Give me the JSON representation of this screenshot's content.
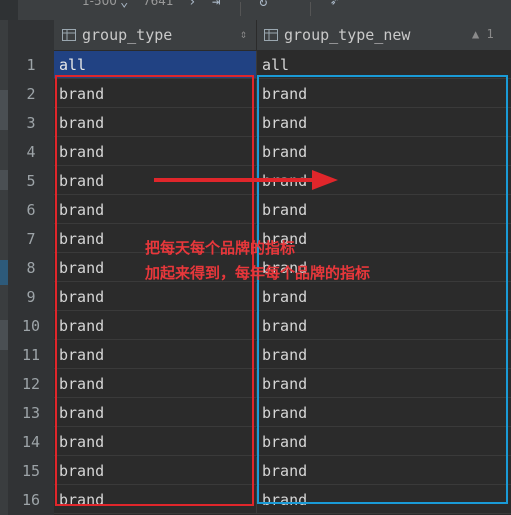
{
  "toolbar": {
    "range_label": "1-500",
    "total_label": "7641"
  },
  "columns": [
    {
      "name": "group_type",
      "sort_indicator": "⇕"
    },
    {
      "name": "group_type_new",
      "sort_indicator": "▲ 1"
    }
  ],
  "rows": [
    {
      "num": "1",
      "group_type": "all",
      "group_type_new": "all"
    },
    {
      "num": "2",
      "group_type": "brand",
      "group_type_new": "brand"
    },
    {
      "num": "3",
      "group_type": "brand",
      "group_type_new": "brand"
    },
    {
      "num": "4",
      "group_type": "brand",
      "group_type_new": "brand"
    },
    {
      "num": "5",
      "group_type": "brand",
      "group_type_new": "brand"
    },
    {
      "num": "6",
      "group_type": "brand",
      "group_type_new": "brand"
    },
    {
      "num": "7",
      "group_type": "brand",
      "group_type_new": "brand"
    },
    {
      "num": "8",
      "group_type": "brand",
      "group_type_new": "brand"
    },
    {
      "num": "9",
      "group_type": "brand",
      "group_type_new": "brand"
    },
    {
      "num": "10",
      "group_type": "brand",
      "group_type_new": "brand"
    },
    {
      "num": "11",
      "group_type": "brand",
      "group_type_new": "brand"
    },
    {
      "num": "12",
      "group_type": "brand",
      "group_type_new": "brand"
    },
    {
      "num": "13",
      "group_type": "brand",
      "group_type_new": "brand"
    },
    {
      "num": "14",
      "group_type": "brand",
      "group_type_new": "brand"
    },
    {
      "num": "15",
      "group_type": "brand",
      "group_type_new": "brand"
    },
    {
      "num": "16",
      "group_type": "brand",
      "group_type_new": "brand"
    }
  ],
  "annotation": {
    "line1": "把每天每个品牌的指标",
    "line2": "加起来得到，每年每个品牌的指标"
  },
  "colors": {
    "annotation_red": "#e0262b",
    "annotation_blue": "#1a9bd7",
    "selection": "#214283"
  }
}
